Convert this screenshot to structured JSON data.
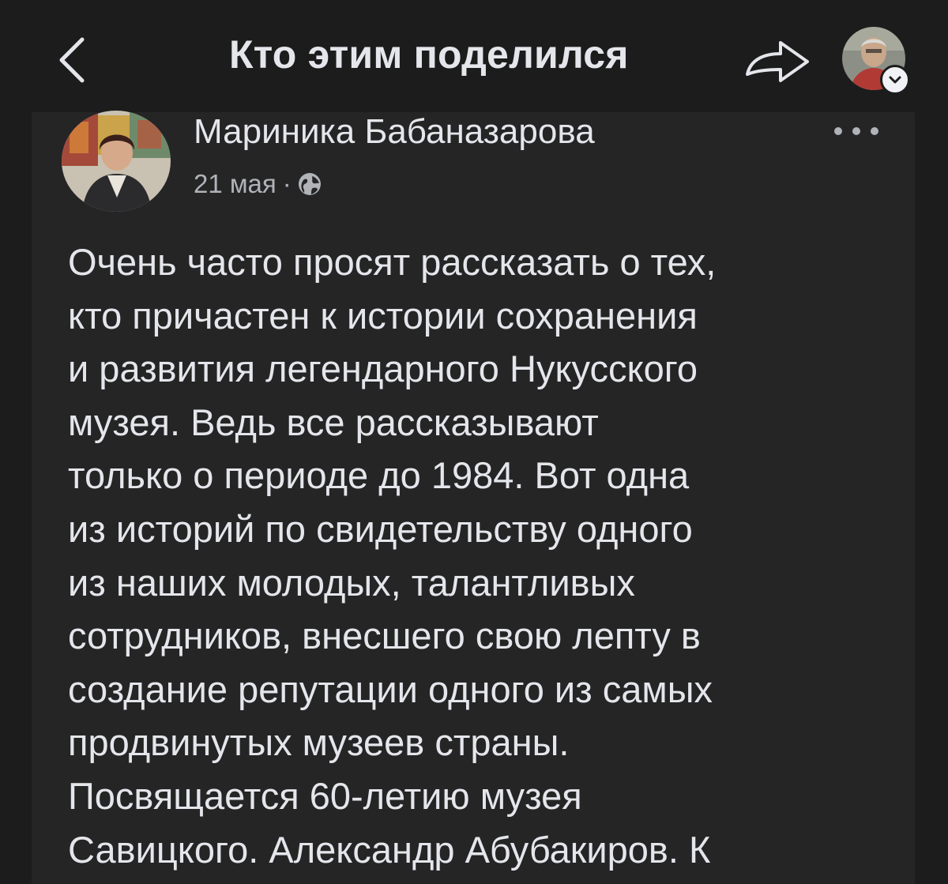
{
  "header": {
    "title": "Кто этим поделился",
    "back_icon": "chevron-left-icon",
    "share_icon": "share-arrow-icon",
    "profile_badge_icon": "chevron-down-icon"
  },
  "post": {
    "author": "Мариника Бабаназарова",
    "date": "21 мая",
    "separator": "·",
    "privacy_icon": "globe-icon",
    "more_icon": "more-horizontal-icon",
    "text_lines": [
      "Очень часто просят рассказать о тех,",
      "кто причастен к истории сохранения",
      "и развития легендарного Нукусского",
      "музея. Ведь все рассказывают",
      "только о периоде до 1984. Вот одна",
      "из историй по свидетельству одного",
      "из наших молодых, талантливых",
      "сотрудников, внесшего свою лепту в",
      "создание репутации одного из самых",
      "продвинутых музеев страны.",
      "Посвящается 60-летию музея",
      "Савицкого. Александр Абубакиров. К"
    ]
  },
  "colors": {
    "background": "#1c1c1d",
    "card": "#252526",
    "text_primary": "#e4e6eb",
    "text_secondary": "#b0b3b8"
  }
}
